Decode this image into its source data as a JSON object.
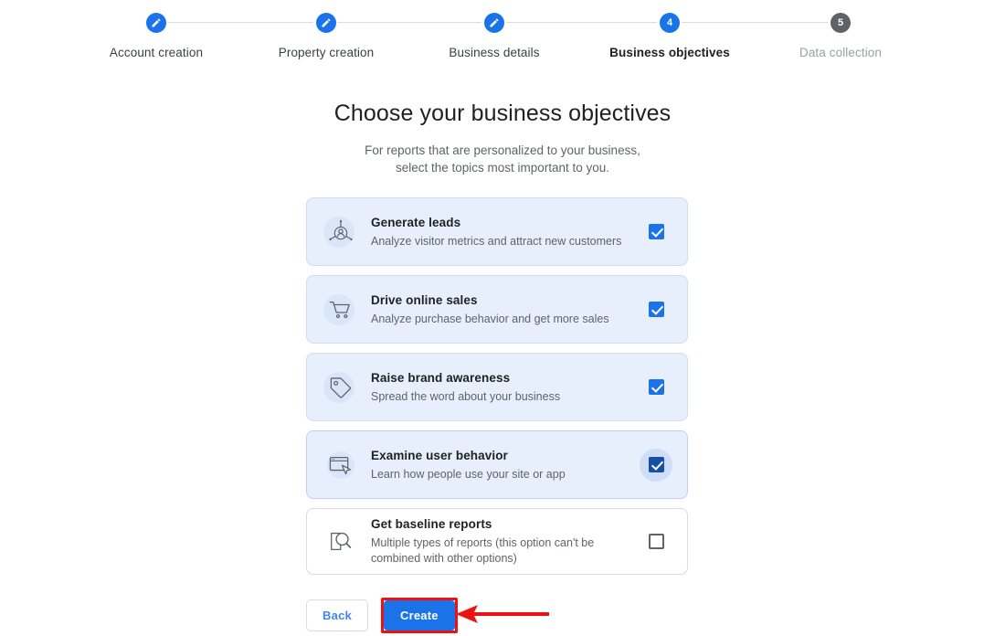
{
  "stepper": {
    "steps": [
      {
        "label": "Account creation",
        "state": "done",
        "marker": "edit-icon"
      },
      {
        "label": "Property creation",
        "state": "done",
        "marker": "edit-icon"
      },
      {
        "label": "Business details",
        "state": "done",
        "marker": "edit-icon"
      },
      {
        "label": "Business objectives",
        "state": "current",
        "marker": "4"
      },
      {
        "label": "Data collection",
        "state": "upcoming",
        "marker": "5"
      }
    ]
  },
  "page": {
    "title": "Choose your business objectives",
    "subtitle_line1": "For reports that are personalized to your business,",
    "subtitle_line2": "select the topics most important to you."
  },
  "objectives": [
    {
      "title": "Generate leads",
      "description": "Analyze visitor metrics and attract new customers",
      "icon": "lead-target-icon",
      "checked": true,
      "pressed": false,
      "focused": false
    },
    {
      "title": "Drive online sales",
      "description": "Analyze purchase behavior and get more sales",
      "icon": "shopping-cart-icon",
      "checked": true,
      "pressed": false,
      "focused": false
    },
    {
      "title": "Raise brand awareness",
      "description": "Spread the word about your business",
      "icon": "tag-icon",
      "checked": true,
      "pressed": false,
      "focused": false
    },
    {
      "title": "Examine user behavior",
      "description": "Learn how people use your site or app",
      "icon": "cursor-window-icon",
      "checked": true,
      "pressed": true,
      "focused": true
    },
    {
      "title": "Get baseline reports",
      "description": "Multiple types of reports (this option can't be combined with other options)",
      "icon": "document-search-icon",
      "checked": false,
      "pressed": false,
      "focused": false
    }
  ],
  "footer": {
    "back_label": "Back",
    "create_label": "Create"
  },
  "annotation": {
    "highlight_color": "#ee1111",
    "arrow_color": "#ee1111",
    "target": "create-button"
  },
  "colors": {
    "accent_blue": "#1a73e8",
    "pressed_blue": "#174ea6",
    "selected_card_bg": "#e8effc",
    "step_inactive": "#5f6368",
    "divider": "#dadce0",
    "body_text": "#202124",
    "secondary_text": "#5f6368"
  }
}
